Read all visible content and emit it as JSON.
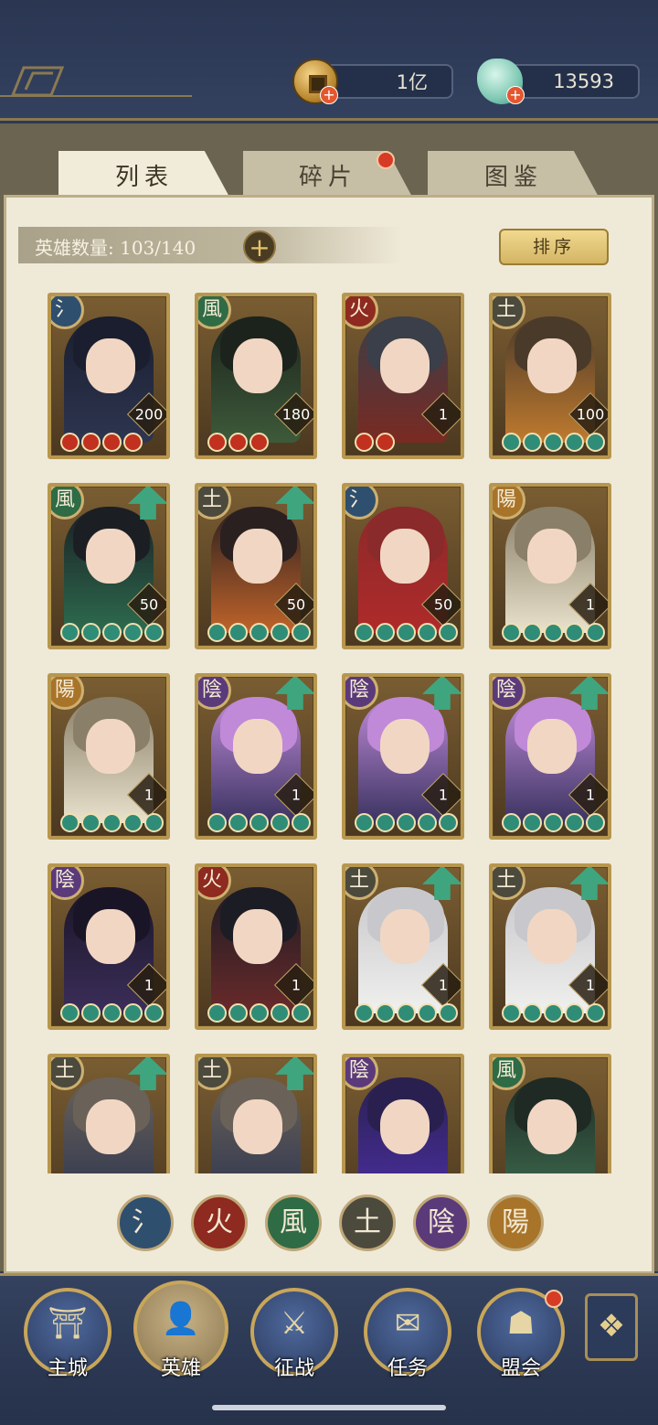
{
  "currency": {
    "coin": {
      "value": "1亿",
      "icon": "coin-icon"
    },
    "jade": {
      "value": "13593",
      "icon": "jade-icon"
    }
  },
  "tabs": [
    {
      "label": "列表",
      "active": true
    },
    {
      "label": "碎片",
      "active": false,
      "badge": true
    },
    {
      "label": "图鉴",
      "active": false
    }
  ],
  "hero_count": {
    "label": "英雄数量: 103/140"
  },
  "sort_label": "排序",
  "heroes": [
    {
      "element": "氵",
      "level": "200",
      "stars": 4,
      "star_color": "red",
      "upgrade": false
    },
    {
      "element": "風",
      "level": "180",
      "stars": 3,
      "star_color": "red",
      "upgrade": false
    },
    {
      "element": "火",
      "level": "1",
      "stars": 2,
      "star_color": "red",
      "upgrade": false
    },
    {
      "element": "土",
      "level": "100",
      "stars": 5,
      "star_color": "green",
      "upgrade": false
    },
    {
      "element": "風",
      "level": "50",
      "stars": 5,
      "star_color": "green",
      "upgrade": true
    },
    {
      "element": "土",
      "level": "50",
      "stars": 5,
      "star_color": "green",
      "upgrade": true
    },
    {
      "element": "氵",
      "level": "50",
      "stars": 5,
      "star_color": "green",
      "upgrade": false
    },
    {
      "element": "陽",
      "level": "1",
      "stars": 5,
      "star_color": "green",
      "upgrade": false
    },
    {
      "element": "陽",
      "level": "1",
      "stars": 5,
      "star_color": "green",
      "upgrade": false
    },
    {
      "element": "陰",
      "level": "1",
      "stars": 5,
      "star_color": "green",
      "upgrade": true
    },
    {
      "element": "陰",
      "level": "1",
      "stars": 5,
      "star_color": "green",
      "upgrade": true
    },
    {
      "element": "陰",
      "level": "1",
      "stars": 5,
      "star_color": "green",
      "upgrade": true
    },
    {
      "element": "陰",
      "level": "1",
      "stars": 5,
      "star_color": "green",
      "upgrade": false
    },
    {
      "element": "火",
      "level": "1",
      "stars": 5,
      "star_color": "green",
      "upgrade": false
    },
    {
      "element": "土",
      "level": "1",
      "stars": 5,
      "star_color": "green",
      "upgrade": true
    },
    {
      "element": "土",
      "level": "1",
      "stars": 5,
      "star_color": "green",
      "upgrade": true
    },
    {
      "element": "土",
      "level": "",
      "stars": 0,
      "star_color": "green",
      "upgrade": true
    },
    {
      "element": "土",
      "level": "",
      "stars": 0,
      "star_color": "green",
      "upgrade": true
    },
    {
      "element": "陰",
      "level": "",
      "stars": 0,
      "star_color": "green",
      "upgrade": false
    },
    {
      "element": "風",
      "level": "",
      "stars": 0,
      "star_color": "green",
      "upgrade": false
    }
  ],
  "element_filters": [
    {
      "symbol": "氵",
      "color": "#2f4f6e"
    },
    {
      "symbol": "火",
      "color": "#8e2a1f"
    },
    {
      "symbol": "風",
      "color": "#2f6b45"
    },
    {
      "symbol": "土",
      "color": "#4c4a3c"
    },
    {
      "symbol": "陰",
      "color": "#5b3a7a"
    },
    {
      "symbol": "陽",
      "color": "#a8742a"
    }
  ],
  "element_colors": {
    "氵": "#2f4f6e",
    "火": "#8e2a1f",
    "風": "#2f6b45",
    "土": "#4c4a3c",
    "陰": "#5b3a7a",
    "陽": "#a8742a"
  },
  "nav": [
    {
      "label": "主城",
      "icon": "city-gate-icon",
      "active": false
    },
    {
      "label": "英雄",
      "icon": "hero-portrait-icon",
      "active": true
    },
    {
      "label": "征战",
      "icon": "battle-icon",
      "active": false
    },
    {
      "label": "任务",
      "icon": "task-scroll-icon",
      "active": false
    },
    {
      "label": "盟会",
      "icon": "alliance-icon",
      "active": false,
      "badge": true
    }
  ],
  "more_icon": "menu-flower-icon"
}
